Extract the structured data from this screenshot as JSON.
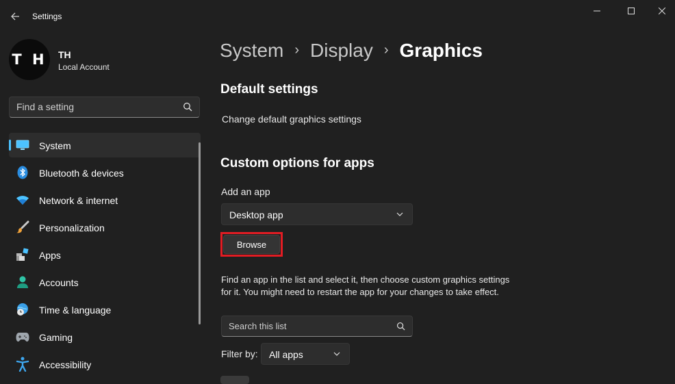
{
  "window": {
    "title": "Settings"
  },
  "user": {
    "initials": "T H",
    "name": "TH",
    "account_type": "Local Account"
  },
  "search": {
    "placeholder": "Find a setting"
  },
  "sidebar": {
    "items": [
      {
        "label": "System",
        "icon": "system-icon",
        "selected": true
      },
      {
        "label": "Bluetooth & devices",
        "icon": "bluetooth-icon"
      },
      {
        "label": "Network & internet",
        "icon": "wifi-icon"
      },
      {
        "label": "Personalization",
        "icon": "brush-icon"
      },
      {
        "label": "Apps",
        "icon": "apps-icon"
      },
      {
        "label": "Accounts",
        "icon": "accounts-icon"
      },
      {
        "label": "Time & language",
        "icon": "globe-clock-icon"
      },
      {
        "label": "Gaming",
        "icon": "gamepad-icon"
      },
      {
        "label": "Accessibility",
        "icon": "accessibility-icon"
      }
    ]
  },
  "breadcrumb": {
    "items": [
      "System",
      "Display"
    ],
    "current": "Graphics"
  },
  "main": {
    "default_heading": "Default settings",
    "default_link": "Change default graphics settings",
    "custom_heading": "Custom options for apps",
    "add_app_label": "Add an app",
    "app_type_value": "Desktop app",
    "browse_label": "Browse",
    "description": "Find an app in the list and select it, then choose custom graphics settings for it. You might need to restart the app for your changes to take effect.",
    "list_search_placeholder": "Search this list",
    "filter_label": "Filter by:",
    "filter_value": "All apps"
  },
  "colors": {
    "background": "#202020",
    "accent": "#4cc2ff",
    "highlight": "#e21c23"
  }
}
